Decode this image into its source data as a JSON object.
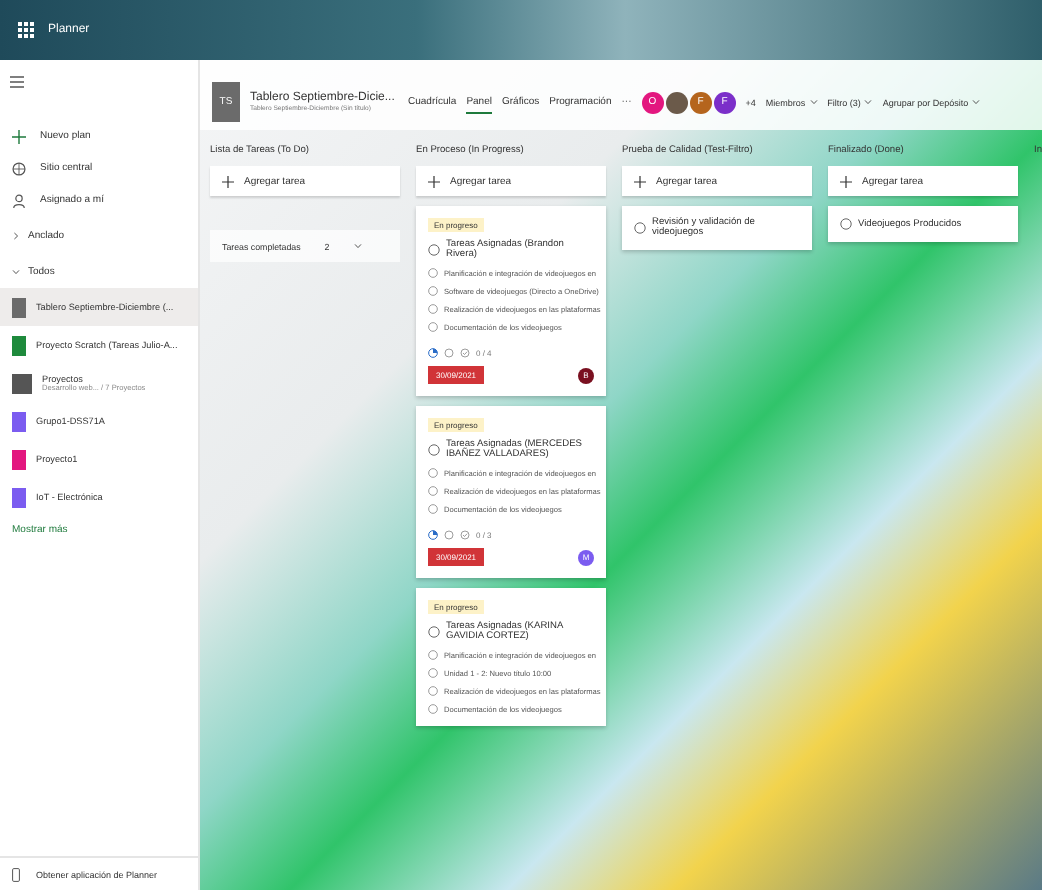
{
  "app_bar": {
    "title": "Planner"
  },
  "sidebar": {
    "nav": [
      {
        "kind": "plus",
        "label": "Nuevo plan"
      },
      {
        "kind": "hub",
        "label": "Sitio central"
      },
      {
        "kind": "person",
        "label": "Asignado a mí"
      }
    ],
    "sections": [
      {
        "label": "Anclado",
        "expanded": false
      },
      {
        "label": "Todos",
        "expanded": true
      }
    ],
    "plans": [
      {
        "kind": "letter",
        "name": "Tablero Septiembre-Diciembre (...",
        "color": "#6b6b6b",
        "selected": true
      },
      {
        "kind": "letter",
        "name": "Proyecto Scratch (Tareas Julio-A...",
        "color": "#1e8a3c",
        "selected": false
      },
      {
        "kind": "photo",
        "name": "Proyectos",
        "subtitle": "Desarrollo web... / 7 Proyectos",
        "color": "#555555",
        "selected": false
      },
      {
        "kind": "letter",
        "name": "Grupo1-DSS71A",
        "color": "#7b5cf0",
        "selected": false
      },
      {
        "kind": "letter",
        "name": "Proyecto1",
        "color": "#e3177f",
        "selected": false
      },
      {
        "kind": "letter",
        "name": "IoT - Electrónica",
        "color": "#7b5cf0",
        "selected": false
      }
    ],
    "show_more": "Mostrar más",
    "footer": "Obtener aplicación de Planner"
  },
  "header": {
    "plan_initials": "TS",
    "plan_title": "Tablero Septiembre-Dicie...",
    "plan_subtitle": "Tablero Septiembre-Diciembre (Sin título)",
    "tabs": [
      {
        "label": "Cuadrícula",
        "selected": false
      },
      {
        "label": "Panel",
        "selected": true
      },
      {
        "label": "Gráficos",
        "selected": false
      },
      {
        "label": "Programación",
        "selected": false
      }
    ],
    "more": "···",
    "avatars": [
      {
        "kind": "letter",
        "initial": "O",
        "color": "#e3177f"
      },
      {
        "kind": "photo",
        "color": "#6b5a4a"
      },
      {
        "kind": "letter",
        "initial": "F",
        "color": "#b5651d"
      },
      {
        "kind": "letter",
        "initial": "F",
        "color": "#7b2fc9"
      }
    ],
    "extra_members": "+4",
    "menus": [
      "Miembros",
      "Filtro (3)",
      "Agrupar por Depósito"
    ]
  },
  "buckets": [
    {
      "name": "Lista de Tareas (To Do)",
      "add_label": "Agregar tarea",
      "completed": {
        "label": "Tareas completadas",
        "count": "2"
      }
    },
    {
      "name": "En Proceso (In Progress)",
      "add_label": "Agregar tarea",
      "cards": [
        {
          "tag": "En progreso",
          "title": "Tareas Asignadas (Brandon Rivera)",
          "checklist": [
            {
              "text": "Planificación e integración de videojuegos en",
              "checked": false
            },
            {
              "text": "Software de videojuegos (Directo a OneDrive)",
              "checked": false
            },
            {
              "text": "Realización de videojuegos en las plataformas",
              "checked": false
            },
            {
              "text": "Documentación de los videojuegos",
              "checked": false
            }
          ],
          "progress": "0 / 4",
          "due": "30/09/2021",
          "assignee": {
            "initial": "B",
            "color": "#7a1020"
          }
        },
        {
          "tag": "En progreso",
          "title": "Tareas Asignadas (MERCEDES IBAÑEZ VALLADARES)",
          "checklist": [
            {
              "text": "Planificación e integración de videojuegos en",
              "checked": false
            },
            {
              "text": "Realización de videojuegos en las plataformas",
              "checked": false
            },
            {
              "text": "Documentación de los videojuegos",
              "checked": false
            }
          ],
          "progress": "0 / 3",
          "due": "30/09/2021",
          "assignee": {
            "initial": "M",
            "color": "#7b5cf0"
          }
        },
        {
          "tag": "En progreso",
          "title": "Tareas Asignadas (KARINA GAVIDIA CORTEZ)",
          "checklist": [
            {
              "text": "Planificación e integración de videojuegos en",
              "checked": false
            },
            {
              "text": "Unidad 1 - 2: Nuevo título 10:00",
              "checked": false
            },
            {
              "text": "Realización de videojuegos en las plataformas",
              "checked": false
            },
            {
              "text": "Documentación de los videojuegos",
              "checked": false
            }
          ]
        }
      ]
    },
    {
      "name": "Prueba de Calidad (Test-Filtro)",
      "add_label": "Agregar tarea",
      "cards": [
        {
          "title": "Revisión y validación de videojuegos"
        }
      ]
    },
    {
      "name": "Finalizado (Done)",
      "add_label": "Agregar tarea",
      "cards": [
        {
          "title": "Videojuegos Producidos"
        }
      ]
    },
    {
      "name": "In"
    }
  ]
}
